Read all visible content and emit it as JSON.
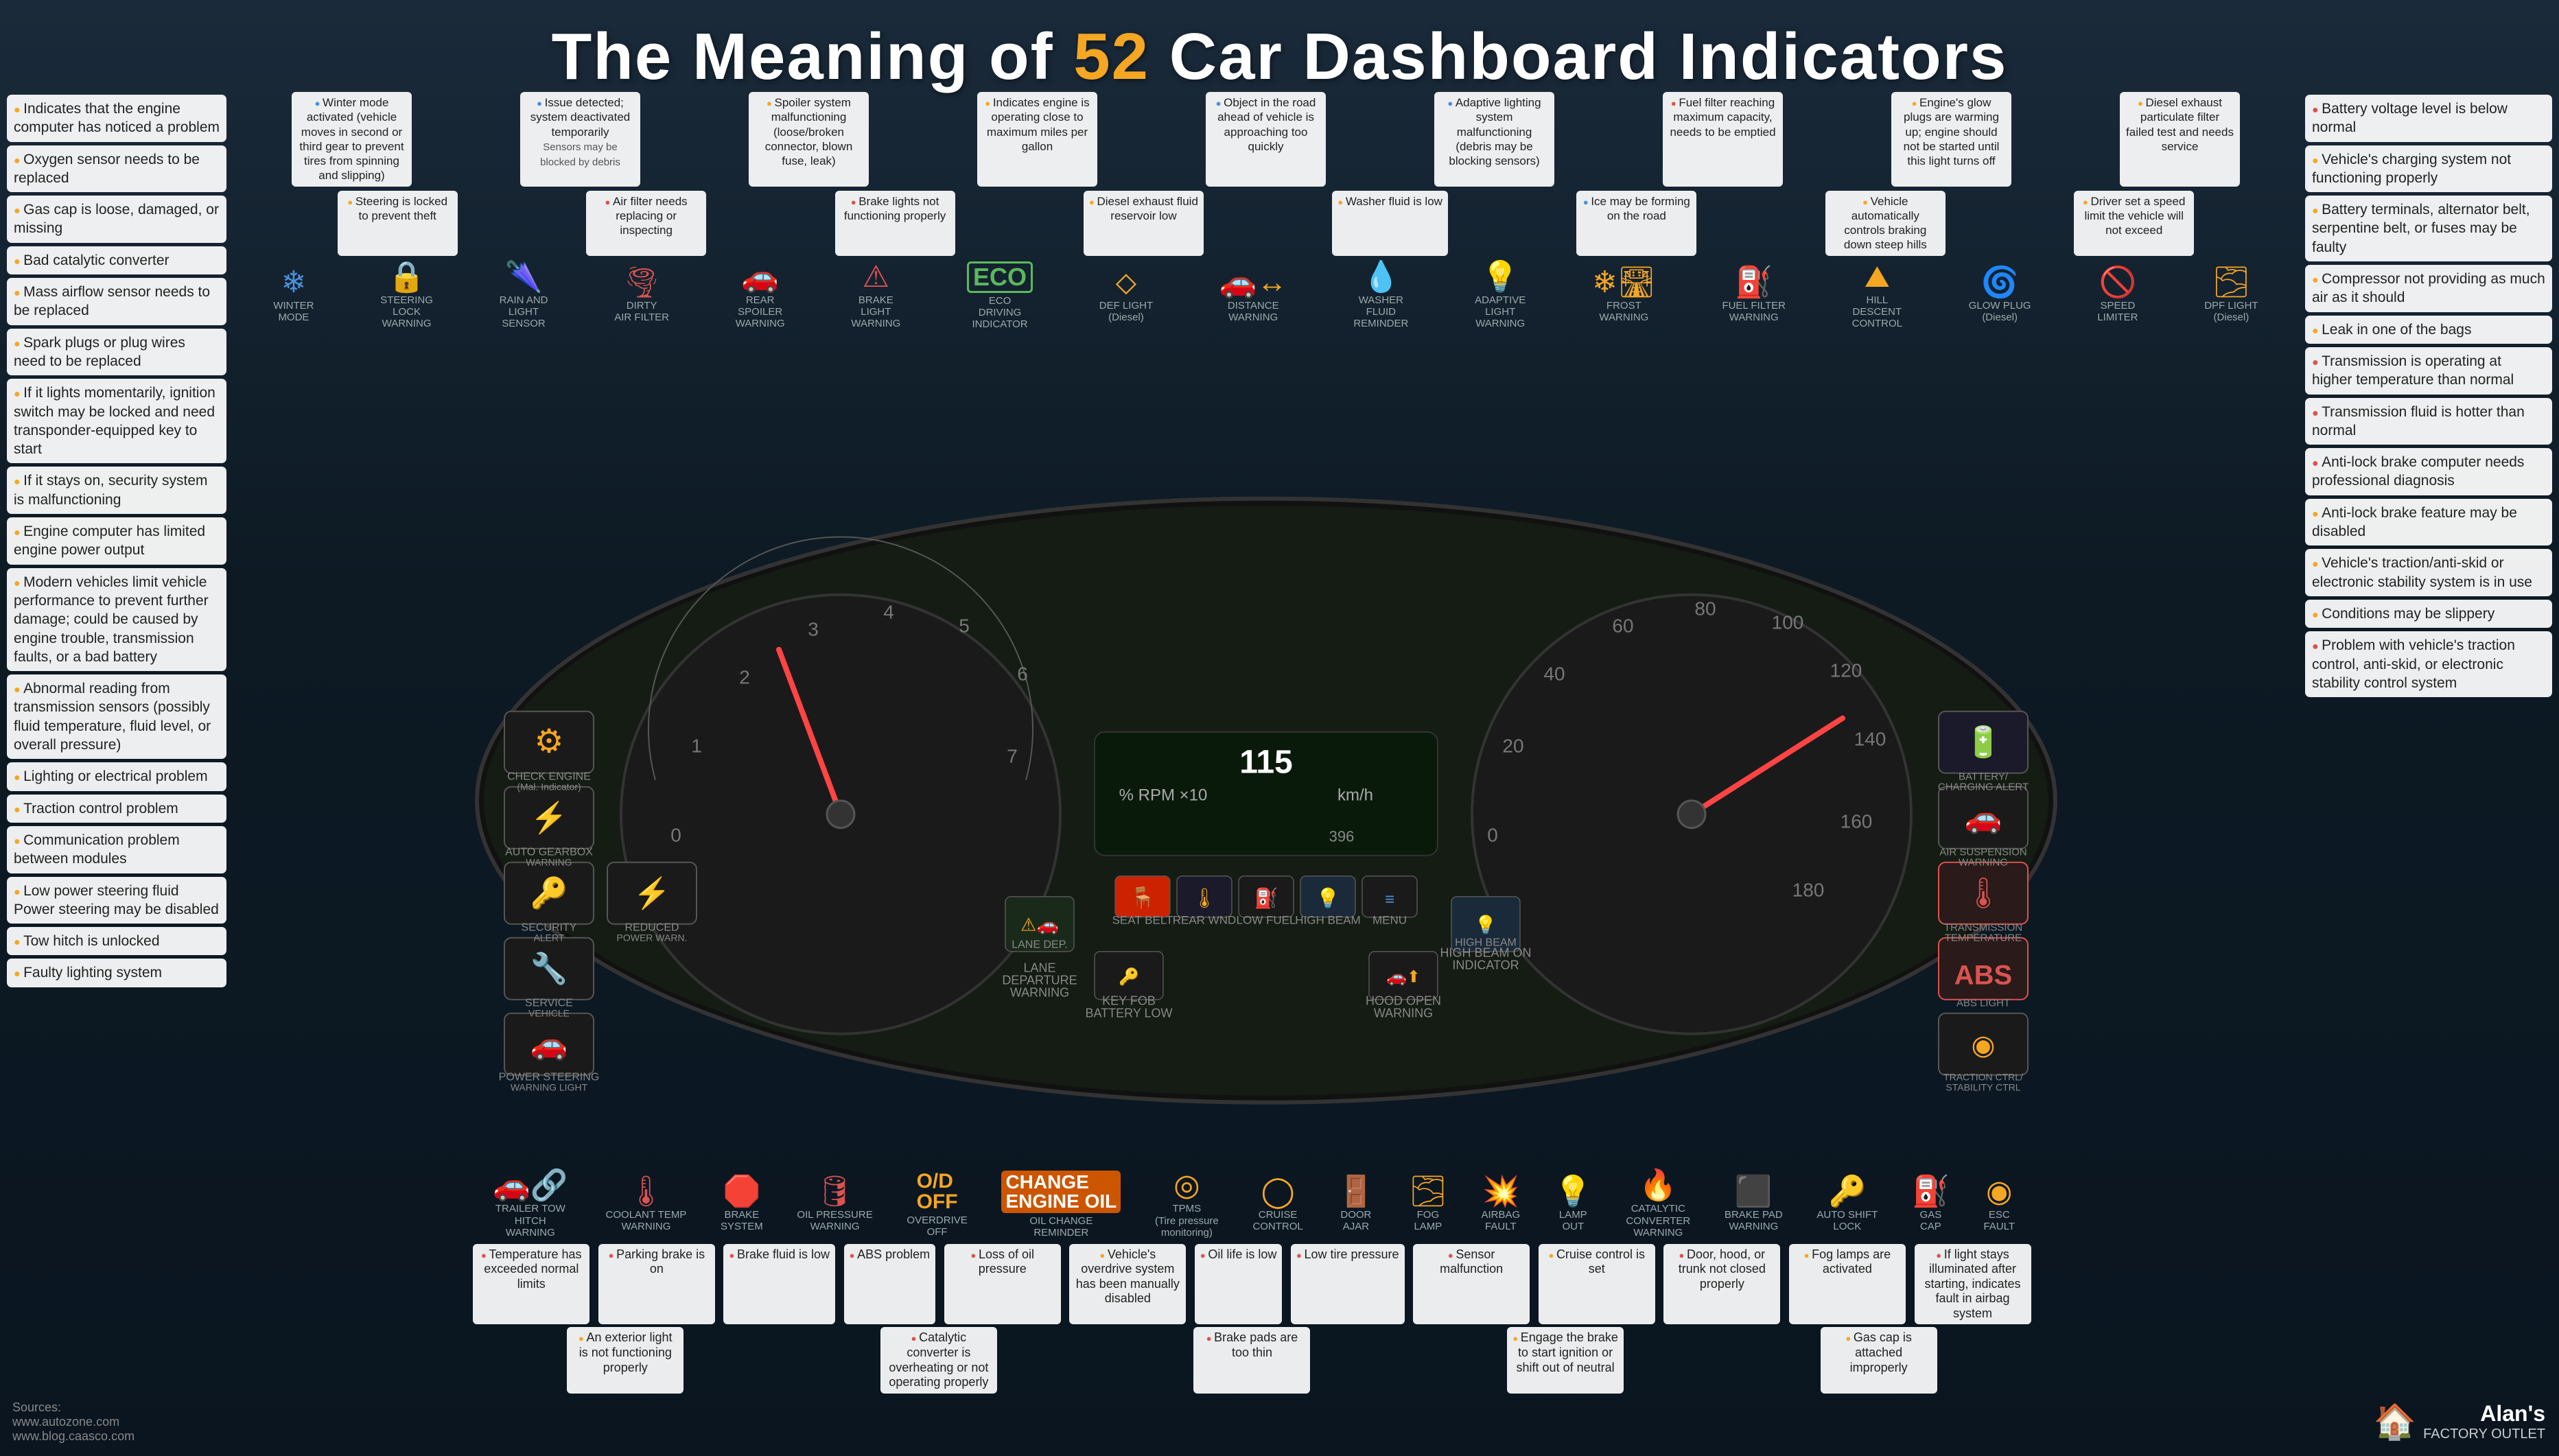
{
  "title": {
    "prefix": "The Meaning of ",
    "number": "52",
    "suffix": " Car Dashboard Indicators"
  },
  "left_callouts": [
    {
      "dot": "yellow",
      "text": "Indicates that the engine computer has noticed a problem"
    },
    {
      "dot": "yellow",
      "text": "Oxygen sensor needs to be replaced"
    },
    {
      "dot": "yellow",
      "text": "Gas cap is loose, damaged, or missing"
    },
    {
      "dot": "yellow",
      "text": "Bad catalytic converter"
    },
    {
      "dot": "yellow",
      "text": "Mass airflow sensor needs to be replaced"
    },
    {
      "dot": "yellow",
      "text": "Spark plugs or plug wires need to be replaced"
    },
    {
      "dot": "yellow",
      "text": "If it lights momentarily, ignition switch may be locked and need transponder-equipped key to start"
    },
    {
      "dot": "yellow",
      "text": "If it stays on, security system is malfunctioning"
    },
    {
      "dot": "yellow",
      "text": "Engine computer has limited engine power output"
    },
    {
      "dot": "yellow",
      "text": "Modern vehicles limit vehicle performance to prevent further damage; could be caused by engine trouble, transmission faults, or a bad battery"
    }
  ],
  "left_mid_callouts": [
    {
      "dot": "yellow",
      "text": "Abnormal reading from transmission sensors (possibly fluid temperature, fluid level, or overall pressure)"
    },
    {
      "dot": "yellow",
      "text": "Lighting or electrical problem"
    },
    {
      "dot": "yellow",
      "text": "Traction control problem"
    },
    {
      "dot": "yellow",
      "text": "Communication problem between modules"
    }
  ],
  "left_bottom_callouts": [
    {
      "dot": "yellow",
      "text": "Low power steering fluid Power steering may be disabled"
    },
    {
      "dot": "yellow",
      "text": "Tow hitch is unlocked"
    },
    {
      "dot": "yellow",
      "text": "Faulty lighting system"
    }
  ],
  "right_callouts": [
    {
      "dot": "red",
      "text": "Battery voltage level is below normal"
    },
    {
      "dot": "yellow",
      "text": "Vehicle's charging system not functioning properly"
    },
    {
      "dot": "yellow",
      "text": "Battery terminals, alternator belt, serpentine belt, or fuses may be faulty"
    },
    {
      "dot": "yellow",
      "text": "Compressor not providing as much air as it should"
    },
    {
      "dot": "yellow",
      "text": "Leak in one of the bags"
    },
    {
      "dot": "red",
      "text": "Transmission is operating at higher temperature than normal"
    },
    {
      "dot": "red",
      "text": "Transmission fluid is hotter than normal"
    },
    {
      "dot": "red",
      "text": "Anti-lock brake computer needs professional diagnosis"
    },
    {
      "dot": "yellow",
      "text": "Anti-lock brake feature may be disabled"
    },
    {
      "dot": "yellow",
      "text": "Vehicle's traction/anti-skid or electronic stability system is in use"
    },
    {
      "dot": "yellow",
      "text": "Conditions may be slippery"
    }
  ],
  "right_bottom_callouts": [
    {
      "dot": "red",
      "text": "Problem with vehicle's traction control, anti-skid, or electronic stability control system"
    }
  ],
  "top_indicators": [
    {
      "sym": "❄",
      "color": "blue",
      "name": "WINTER MODE",
      "callout": "Winter mode activated (vehicle moves in second or third gear to prevent tires from spinning and slipping)",
      "dot": "blue"
    },
    {
      "sym": "🔒",
      "color": "yellow",
      "name": "STEERING LOCK WARNING",
      "callout": "Steering is locked to prevent theft",
      "dot": "yellow"
    },
    {
      "sym": "🌧",
      "color": "yellow",
      "name": "RAIN AND LIGHT SENSOR",
      "callout_top": "Issue detected; system deactivated temporarily",
      "callout_bot": "Sensors may be blocked by debris",
      "dot": "blue"
    },
    {
      "sym": "🚗💨",
      "color": "yellow",
      "name": "DIRTY AIR FILTER",
      "callout": "Air filter needs replacing or inspecting",
      "dot": "red"
    },
    {
      "sym": "🚗⬆",
      "color": "yellow",
      "name": "REAR SPOILER WARNING",
      "callout": "Spoiler system malfunctioning (loose/broken connector, blown fuse, leak)",
      "dot": "yellow"
    },
    {
      "sym": "💡",
      "color": "red",
      "name": "BRAKE LIGHT WARNING",
      "callout": "Brake lights not functioning properly",
      "dot": "red"
    },
    {
      "sym": "ECO",
      "color": "green",
      "name": "ECO DRIVING INDICATOR",
      "callout": "Indicates engine is operating close to maximum miles per gallon",
      "dot": "yellow"
    },
    {
      "sym": "⚠",
      "color": "yellow",
      "name": "DEF LIGHT (Diesel)",
      "callout": "",
      "dot": "yellow"
    },
    {
      "sym": "📏",
      "color": "yellow",
      "name": "DISTANCE WARNING",
      "callout": "Object in the road ahead of vehicle is approaching too quickly",
      "dot": "blue"
    },
    {
      "sym": "💧",
      "color": "yellow",
      "name": "WASHER FLUID REMINDER",
      "callout": "Washer fluid is low",
      "dot": "yellow"
    },
    {
      "sym": "💡",
      "color": "blue",
      "name": "ADAPTIVE LIGHT WARNING",
      "callout": "Adaptive lighting system malfunctioning (debris may be blocking sensors)",
      "dot": "blue"
    },
    {
      "sym": "❄🛣",
      "color": "yellow",
      "name": "FROST WARNING",
      "callout": "Ice may be forming on the road",
      "dot": "blue"
    },
    {
      "sym": "⛽",
      "color": "red",
      "name": "FUEL FILTER WARNING",
      "callout": "Fuel filter reaching maximum capacity, needs to be emptied",
      "dot": "red"
    },
    {
      "sym": "⛰",
      "color": "yellow",
      "name": "HILL DESCENT CONTROL",
      "callout": "Vehicle automatically controls braking down steep hills",
      "dot": "yellow"
    },
    {
      "sym": "🔌",
      "color": "yellow",
      "name": "GLOW PLUG (Diesel)",
      "callout": "Engine's glow plugs are warming up; engine should not be started until this light turns off",
      "dot": "yellow"
    },
    {
      "sym": "V",
      "color": "yellow",
      "name": "SPEED LIMITER",
      "callout": "Driver set a speed limit the vehicle will not exceed",
      "dot": "yellow"
    },
    {
      "sym": "🌫",
      "color": "yellow",
      "name": "DPF LIGHT (Diesel)",
      "callout": "Diesel exhaust particulate filter failed test and needs service",
      "dot": "yellow"
    }
  ],
  "middle_indicators": [
    {
      "sym": "⚙",
      "color": "yellow",
      "name": "CHECK ENGINE\n(or Malfunction\nIndicator Light)",
      "left": true
    },
    {
      "sym": "⚙",
      "color": "yellow",
      "name": "AUTOMATIC\nGEARBOX\nWARNING",
      "left": true
    },
    {
      "sym": "🔑",
      "color": "yellow",
      "name": "SECURITY\nALERT",
      "left": true
    },
    {
      "sym": "🔧",
      "color": "yellow",
      "name": "SERVICE\nVEHICLE",
      "left": true
    },
    {
      "sym": "⚡",
      "color": "yellow",
      "name": "REDUCED\nPOWER\nWARNING",
      "left": true
    },
    {
      "sym": "🚗",
      "color": "yellow",
      "name": "POWER\nSTEERING\nWARNING LIGHT",
      "left": true
    }
  ],
  "inner_indicators": [
    {
      "sym": "🪑",
      "color": "red",
      "name": "SEAT BELT\nREMINDER\nLIGHT"
    },
    {
      "sym": "🌡",
      "color": "yellow",
      "name": "REAR WINDOW\nDEFROST"
    },
    {
      "sym": "⛽",
      "color": "yellow",
      "name": "LOW FUEL\nINDICATOR"
    },
    {
      "sym": "💡",
      "color": "blue",
      "name": "HIGH BEAM ON\nINDICATOR"
    },
    {
      "sym": "🚗↔",
      "color": "yellow",
      "name": "LANE\nDEPARTURE\nWARNING"
    },
    {
      "sym": "🔑",
      "color": "yellow",
      "name": "KEY FOB\nBATTERY LOW"
    },
    {
      "sym": "🚗⬆",
      "color": "yellow",
      "name": "HOOD OPEN\nWARNING"
    }
  ],
  "right_middle_indicators": [
    {
      "sym": "🔋",
      "color": "yellow",
      "name": "BATTERY/CHARGING\nALERT",
      "right": true
    },
    {
      "sym": "🚗",
      "color": "yellow",
      "name": "AIR\nSUSPENSION\nWARNING",
      "right": true
    },
    {
      "sym": "🌡",
      "color": "red",
      "name": "TRANSMISSION\nTEMPERATURE",
      "right": true
    },
    {
      "sym": "ABS",
      "color": "red",
      "name": "ABS\nLIGHT",
      "right": true
    },
    {
      "sym": "◉",
      "color": "yellow",
      "name": "TRACTION\nCONTROL OR\nELECTRONIC\nSTABILITY CONTROL",
      "right": true
    }
  ],
  "bottom_indicators": [
    {
      "sym": "🚛",
      "color": "yellow",
      "name": "TRAILER TOW\nHITCH WARNING"
    },
    {
      "sym": "🌡",
      "color": "red",
      "name": "COOLANT\nTEMP\nWARNING"
    },
    {
      "sym": "🛑",
      "color": "red",
      "name": "BRAKE\nSYSTEM"
    },
    {
      "sym": "🛢",
      "color": "yellow",
      "name": "OIL PRESSURE\nWARNING"
    },
    {
      "sym": "O/D OFF",
      "color": "yellow",
      "name": "OVERDRIVE\nOFF"
    },
    {
      "sym": "🔄",
      "color": "orange",
      "name": "CHANGE\nENGINE OIL\nOIL CHANGE\nREMINDER"
    },
    {
      "sym": "◎",
      "color": "yellow",
      "name": "TPMS\n(Tire pressure\nmonitoring\nsystem)"
    },
    {
      "sym": "◯",
      "color": "yellow",
      "name": "CRUISE\nCONTROL"
    },
    {
      "sym": "🚗🚪",
      "color": "yellow",
      "name": "DOOR\nAJAR"
    },
    {
      "sym": "🌫",
      "color": "yellow",
      "name": "FOG\nLAMP"
    },
    {
      "sym": "🚗",
      "color": "red",
      "name": "AIRBAG\nFAULT"
    },
    {
      "sym": "💡",
      "color": "yellow",
      "name": "LAMP\nOUT"
    },
    {
      "sym": "🔥",
      "color": "red",
      "name": "CATALYTIC\nCONVERTER\nWARNING"
    },
    {
      "sym": "🛑",
      "color": "red",
      "name": "BRAKE PAD\nWARNING"
    },
    {
      "sym": "🔑",
      "color": "yellow",
      "name": "AUTOMATIC\nSHIFT LOCK\n(or Engine Start\nIndicator)"
    },
    {
      "sym": "⛽🔴",
      "color": "yellow",
      "name": "GAS CAP"
    },
    {
      "sym": "◉",
      "color": "yellow",
      "name": "ESC FAULT"
    }
  ],
  "bottom_callouts_row1": [
    {
      "text": "Temperature has exceeded normal limits",
      "dot": "red"
    },
    {
      "text": "Parking brake is on",
      "dot": "red"
    },
    {
      "text": "Brake fluid is low",
      "dot": "red"
    },
    {
      "text": "ABS problem",
      "dot": "red"
    },
    {
      "text": "Loss of oil pressure",
      "dot": "red"
    },
    {
      "text": "Vehicle's overdrive system has been manually disabled",
      "dot": "yellow"
    },
    {
      "text": "Oil life is low",
      "dot": "red"
    },
    {
      "text": "Low tire pressure",
      "dot": "red"
    },
    {
      "text": "Sensor malfunction",
      "dot": "red"
    },
    {
      "text": "Cruise control is set",
      "dot": "yellow"
    },
    {
      "text": "Door, hood, or trunk not closed properly",
      "dot": "red"
    },
    {
      "text": "Fog lamps are activated",
      "dot": "yellow"
    },
    {
      "text": "If light stays illuminated after starting, indicates fault in airbag system",
      "dot": "red"
    },
    {
      "text": "An exterior light is not functioning properly",
      "dot": "yellow"
    },
    {
      "text": "Catalytic converter is overheating or not operating properly",
      "dot": "red"
    },
    {
      "text": "Brake pads are too thin",
      "dot": "red"
    },
    {
      "text": "Engage the brake to start ignition or shift out of neutral",
      "dot": "yellow"
    },
    {
      "text": "Gas cap is attached improperly",
      "dot": "yellow"
    }
  ],
  "sources": {
    "label": "Sources:",
    "links": [
      "www.autozone.com",
      "www.blog.caasco.com"
    ]
  },
  "brand": {
    "name": "Alan's",
    "sub": "FACTORY OUTLET",
    "icon": "🏠"
  }
}
